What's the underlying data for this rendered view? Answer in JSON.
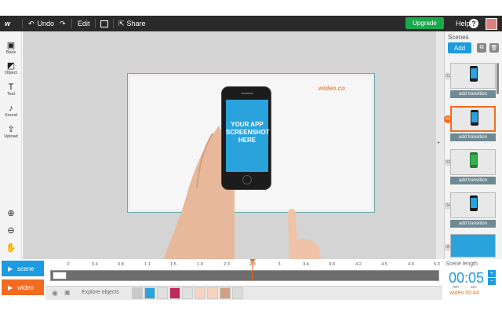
{
  "topbar": {
    "logo": "w",
    "undo": "Undo",
    "edit": "Edit",
    "share": "Share",
    "upgrade": "Upgrade",
    "help": "Help"
  },
  "left_tools": [
    {
      "label": "Back",
      "icon": "image-icon"
    },
    {
      "label": "Object",
      "icon": "object-icon"
    },
    {
      "label": "Text",
      "icon": "text-icon"
    },
    {
      "label": "Sound",
      "icon": "music-icon"
    },
    {
      "label": "Upload",
      "icon": "upload-icon"
    }
  ],
  "canvas": {
    "phone_text": [
      "YOUR APP",
      "SCREENSHOT",
      "HERE"
    ],
    "watermark": "wideo.co"
  },
  "scenes_panel": {
    "title": "Scenes",
    "add_label": "Add",
    "scenes": [
      {
        "number": "01",
        "transition": "add transition",
        "active": false
      },
      {
        "number": "02",
        "transition": "add transition",
        "active": true
      },
      {
        "number": "03",
        "transition": "add transition",
        "active": false
      },
      {
        "number": "04",
        "transition": "add transition",
        "active": false
      },
      {
        "number": "05",
        "transition": "",
        "active": false
      }
    ]
  },
  "timeline": {
    "scene_label": "scene",
    "wideo_label": "wideo",
    "ticks": [
      "0",
      "0.4",
      "0.8",
      "1.1",
      "1.5",
      "1.9",
      "2.3",
      "2.8",
      "3",
      "3.4",
      "3.8",
      "4.2",
      "4.5",
      "4.9",
      "5.3"
    ],
    "explore": "Explore objects",
    "scene_length_label": "Scene length",
    "scene_length_value": "00:05",
    "minute_label": "min",
    "second_label": "sec",
    "wideo_length": "wideo 00:44"
  },
  "colors": {
    "accent_blue": "#1d9be0",
    "accent_orange": "#f26b21",
    "upgrade_green": "#1aa84d"
  }
}
